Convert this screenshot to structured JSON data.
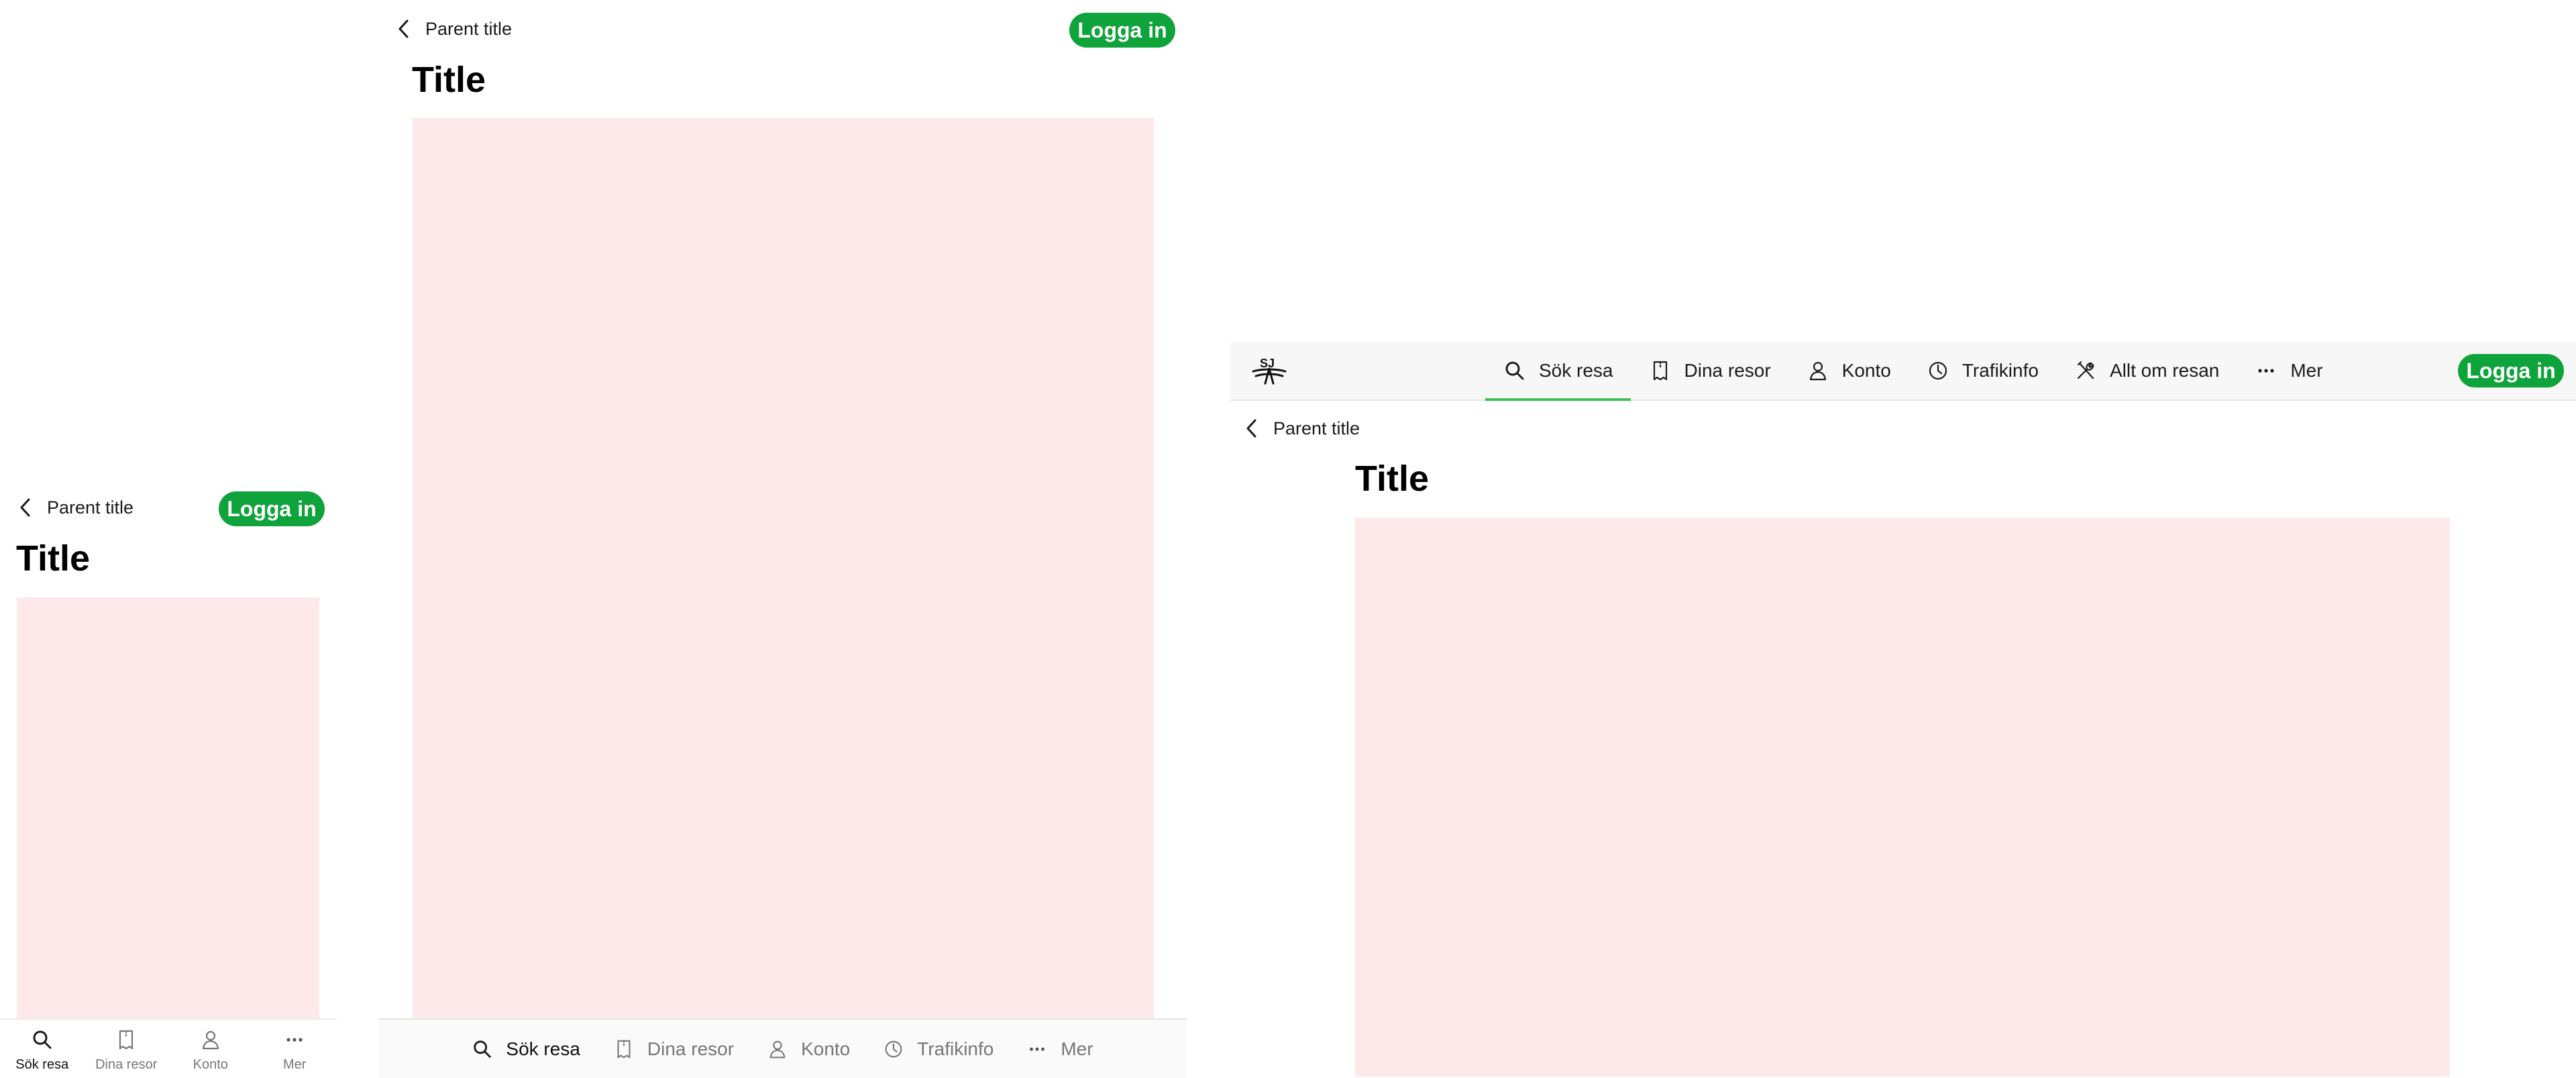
{
  "common": {
    "parent_title": "Parent title",
    "title": "Title",
    "login_label": "Logga in"
  },
  "nav": {
    "search": "Sök resa",
    "trips": "Dina resor",
    "account": "Konto",
    "traffic": "Trafikinfo",
    "about": "Allt om resan",
    "more": "Mer"
  },
  "logo_text": "SJ",
  "colors": {
    "accent": "#0ea33b",
    "active_indicator": "#3fbf5a",
    "placeholder": "#fde9e9"
  }
}
